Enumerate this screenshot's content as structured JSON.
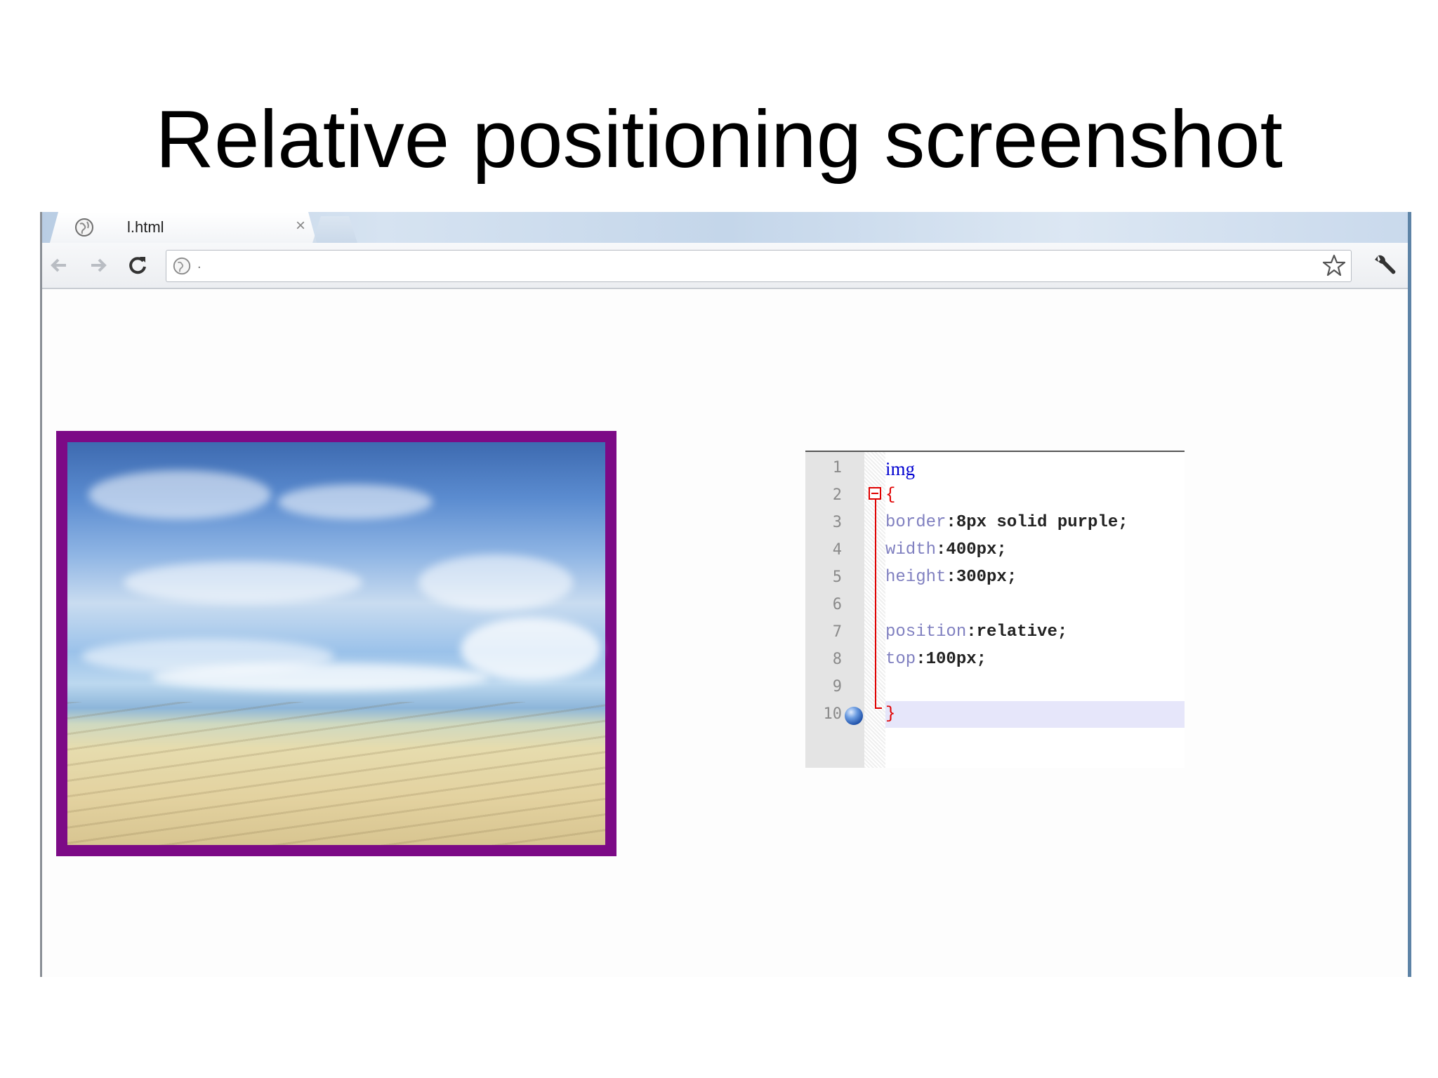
{
  "slide": {
    "title": "Relative positioning screenshot"
  },
  "browser": {
    "tab": {
      "title": "l.html",
      "close_glyph": "×",
      "icon": "globe-icon"
    },
    "toolbar": {
      "back_icon": "back-arrow-icon",
      "forward_icon": "forward-arrow-icon",
      "reload_icon": "reload-icon",
      "url": ".",
      "bookmark_icon": "star-icon",
      "menu_icon": "wrench-icon"
    }
  },
  "page": {
    "image": {
      "description_icon": "beach-photo",
      "border_color": "#7c0a86"
    }
  },
  "code_editor": {
    "lines": [
      {
        "n": "1",
        "parts": [
          {
            "t": "img",
            "c": "sel"
          }
        ]
      },
      {
        "n": "2",
        "parts": [
          {
            "t": "{",
            "c": "brace"
          }
        ]
      },
      {
        "n": "3",
        "parts": [
          {
            "t": "border",
            "c": "prop"
          },
          {
            "t": ":8px solid purple;",
            "c": "val"
          }
        ]
      },
      {
        "n": "4",
        "parts": [
          {
            "t": "width",
            "c": "prop"
          },
          {
            "t": ":400px;",
            "c": "val"
          }
        ]
      },
      {
        "n": "5",
        "parts": [
          {
            "t": "height",
            "c": "prop"
          },
          {
            "t": ":300px;",
            "c": "val"
          }
        ]
      },
      {
        "n": "6",
        "parts": []
      },
      {
        "n": "7",
        "parts": [
          {
            "t": "position",
            "c": "prop"
          },
          {
            "t": ":relative;",
            "c": "val"
          }
        ]
      },
      {
        "n": "8",
        "parts": [
          {
            "t": "top",
            "c": "prop"
          },
          {
            "t": ":100px;",
            "c": "val"
          }
        ]
      },
      {
        "n": "9",
        "parts": []
      },
      {
        "n": "10",
        "parts": [
          {
            "t": "}",
            "c": "brace"
          }
        ]
      }
    ],
    "current_line": "10",
    "colors": {
      "selector": "#0000d0",
      "property": "#8080c0",
      "brace": "#e00000",
      "current_line_bg": "#e6e6fa"
    }
  }
}
